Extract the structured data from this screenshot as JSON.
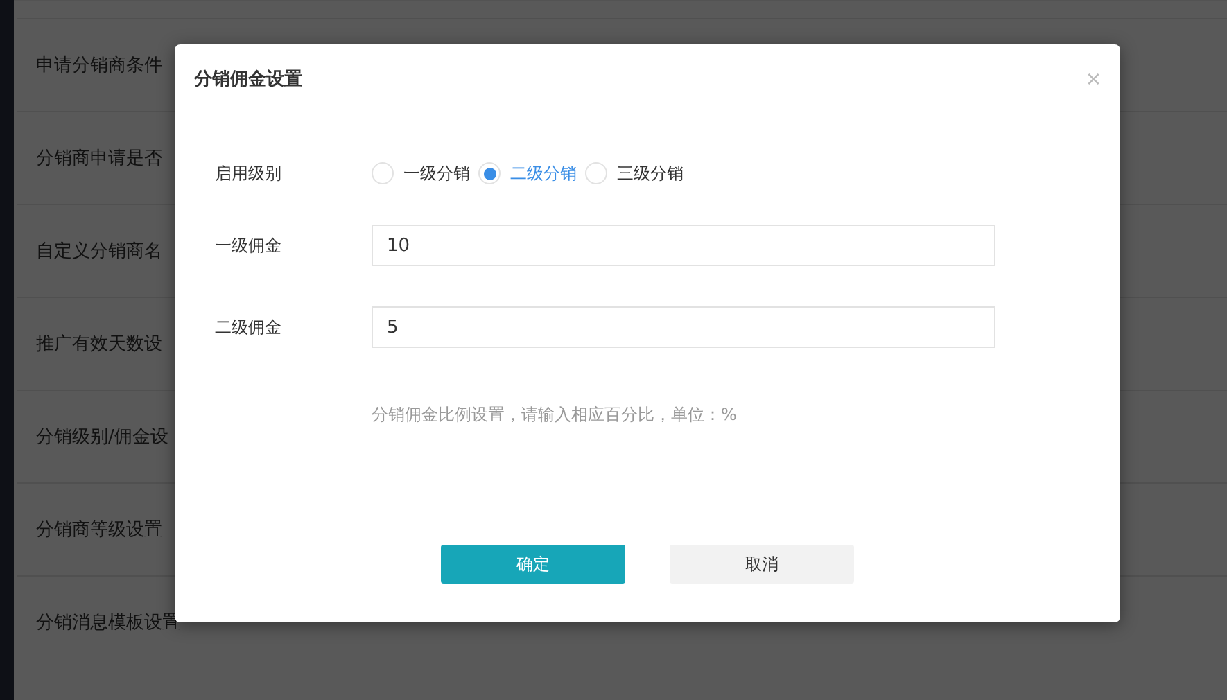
{
  "settings_rows": [
    {
      "label": "申请分销商条件"
    },
    {
      "label": "分销商申请是否"
    },
    {
      "label": "自定义分销商名"
    },
    {
      "label": "推广有效天数设"
    },
    {
      "label": "分销级别/佣金设"
    },
    {
      "label": "分销商等级设置"
    },
    {
      "label": "分销消息模板设置"
    }
  ],
  "dialog": {
    "title": "分销佣金设置",
    "close": "×",
    "level_label": "启用级别",
    "levels": [
      {
        "label": "一级分销",
        "selected": false
      },
      {
        "label": "二级分销",
        "selected": true
      },
      {
        "label": "三级分销",
        "selected": false
      }
    ],
    "fields": [
      {
        "label": "一级佣金",
        "value": "10"
      },
      {
        "label": "二级佣金",
        "value": "5"
      }
    ],
    "hint": "分销佣金比例设置，请输入相应百分比，单位：%",
    "buttons": [
      {
        "label": "确定",
        "kind": "primary"
      },
      {
        "label": "取消",
        "kind": "secondary"
      }
    ]
  }
}
